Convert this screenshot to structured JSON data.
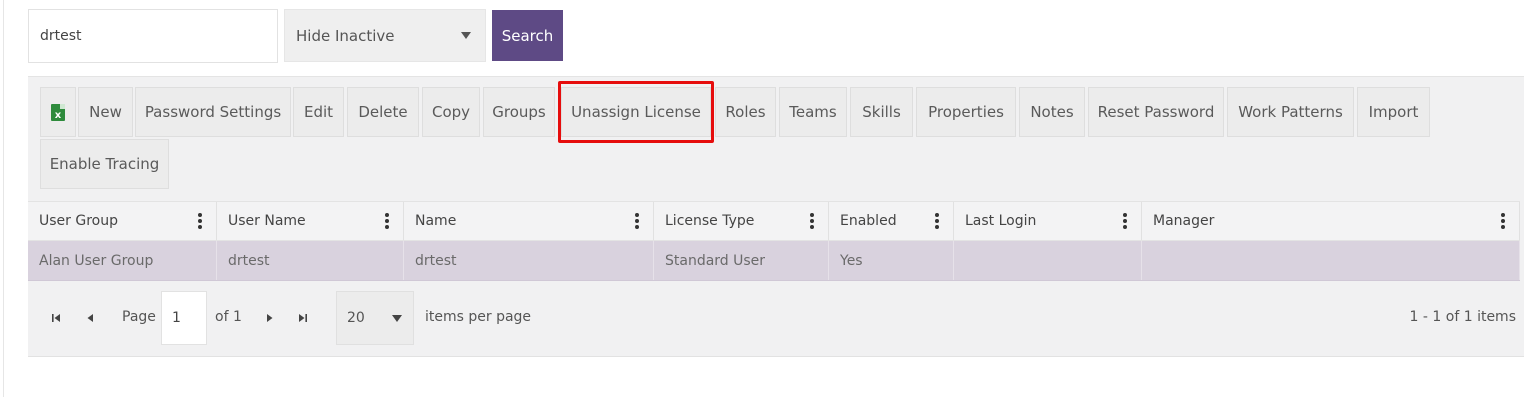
{
  "search": {
    "value": "drtest"
  },
  "filter": {
    "selected": "Hide Inactive"
  },
  "search_button": {
    "label": "Search"
  },
  "toolbar": {
    "export_icon": "excel-icon",
    "buttons": [
      "New",
      "Password Settings",
      "Edit",
      "Delete",
      "Copy",
      "Groups",
      "Unassign License",
      "Roles",
      "Teams",
      "Skills",
      "Properties",
      "Notes",
      "Reset Password",
      "Work Patterns",
      "Import",
      "Enable Tracing"
    ]
  },
  "grid": {
    "columns": [
      "User Group",
      "User Name",
      "Name",
      "License Type",
      "Enabled",
      "Last Login",
      "Manager"
    ],
    "rows": [
      [
        "Alan User Group",
        "drtest",
        "drtest",
        "Standard User",
        "Yes",
        "",
        ""
      ]
    ]
  },
  "pager": {
    "page_label": "Page",
    "page": "1",
    "of_label": "of 1",
    "page_size": "20",
    "items_per_page_label": "items per page",
    "summary": "1 - 1 of 1 items"
  },
  "colors": {
    "accent": "#5e4a85",
    "highlight": "#e60d0d",
    "selected_row": "#d9d2de"
  }
}
